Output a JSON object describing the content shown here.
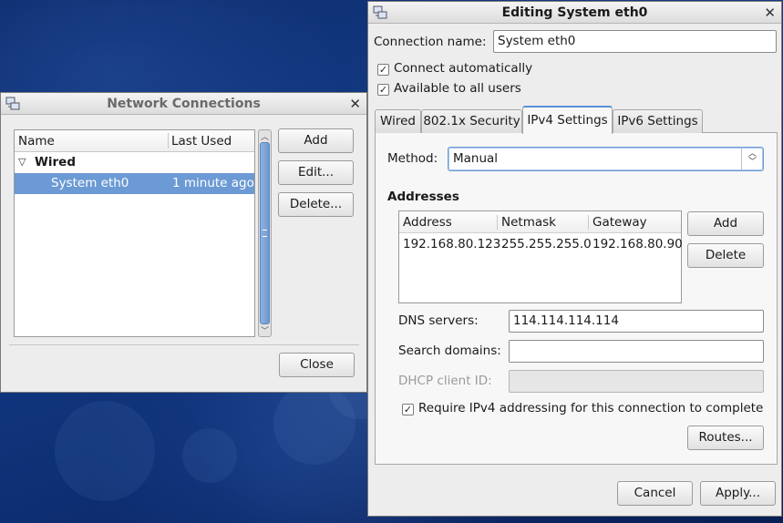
{
  "network_connections": {
    "title": "Network Connections",
    "columns": [
      "Name",
      "Last Used"
    ],
    "groups": [
      {
        "label": "Wired",
        "items": [
          {
            "name": "System eth0",
            "last_used": "1 minute ago"
          }
        ]
      }
    ],
    "buttons": {
      "add": "Add",
      "edit": "Edit...",
      "delete": "Delete...",
      "close": "Close"
    }
  },
  "editor": {
    "title": "Editing System eth0",
    "connection_name_label": "Connection name:",
    "connection_name_value": "System eth0",
    "connect_automatically": {
      "label": "Connect automatically",
      "checked": true
    },
    "available_to_all": {
      "label": "Available to all users",
      "checked": true
    },
    "tabs": [
      {
        "label": "Wired",
        "active": false
      },
      {
        "label": "802.1x Security",
        "active": false
      },
      {
        "label": "IPv4 Settings",
        "active": true
      },
      {
        "label": "IPv6 Settings",
        "active": false
      }
    ],
    "method_label": "Method:",
    "method_value": "Manual",
    "addresses_heading": "Addresses",
    "address_columns": [
      "Address",
      "Netmask",
      "Gateway"
    ],
    "addresses": [
      {
        "address": "192.168.80.123",
        "netmask": "255.255.255.0",
        "gateway": "192.168.80.90"
      }
    ],
    "address_buttons": {
      "add": "Add",
      "delete": "Delete"
    },
    "dns_label": "DNS servers:",
    "dns_value": "114.114.114.114",
    "search_label": "Search domains:",
    "search_value": "",
    "dhcp_label": "DHCP client ID:",
    "dhcp_value": "",
    "require_ipv4": {
      "label": "Require IPv4 addressing for this connection to complete",
      "checked": true
    },
    "routes_button": "Routes...",
    "cancel_button": "Cancel",
    "apply_button": "Apply..."
  },
  "colors": {
    "selection": "#6b9ad4",
    "active_tab_accent": "#5a8fd6",
    "desktop": "#0d2a63"
  }
}
